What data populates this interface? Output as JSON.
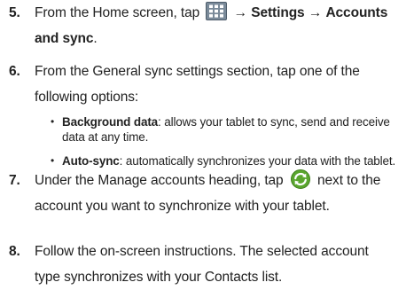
{
  "steps": [
    {
      "number": "5.",
      "line1_pre": "From the Home screen, tap",
      "icon1": "apps-grid-icon",
      "arrow1": "→",
      "settings": "Settings",
      "arrow2": "→",
      "accounts": "Accounts",
      "line2_bold": "and sync",
      "line2_end": "."
    },
    {
      "number": "6.",
      "line1": "From the General sync settings section, tap one of the",
      "line2": "following options:"
    },
    {
      "number": "7.",
      "line1_pre": "Under the Manage accounts heading, tap",
      "icon": "sync-icon",
      "line1_post": "next to the",
      "line2": "account you want to synchronize with your tablet."
    },
    {
      "number": "8.",
      "line1": "Follow the on-screen instructions. The selected account",
      "line2": "type synchronizes with your Contacts list."
    }
  ],
  "options": [
    {
      "bullet": "•",
      "term": "Background data",
      "desc_line1": ": allows your tablet to sync, send and receive",
      "desc_line2": "data at any time."
    },
    {
      "bullet": "•",
      "term": "Auto-sync",
      "desc_line1": ": automatically synchronizes your data with the tablet."
    }
  ],
  "colors": {
    "text": "#222222",
    "sync_icon": "#5aa62e"
  }
}
